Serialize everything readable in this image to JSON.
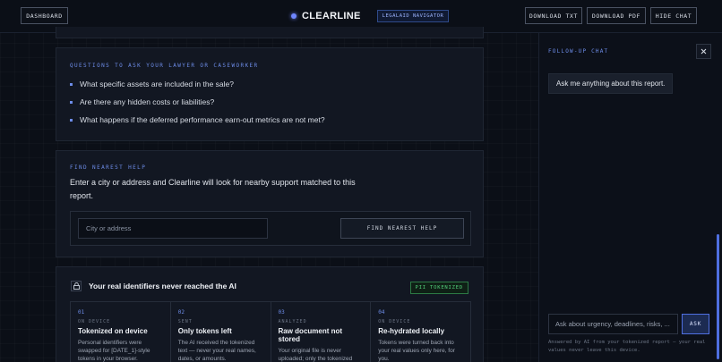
{
  "topbar": {
    "dashboard_label": "DASHBOARD",
    "brand_name": "CLEARLINE",
    "brand_tag": "LEGALAID NAVIGATOR",
    "download_txt_label": "DOWNLOAD TXT",
    "download_pdf_label": "DOWNLOAD PDF",
    "hide_chat_label": "HIDE CHAT"
  },
  "questions": {
    "label": "QUESTIONS TO ASK YOUR LAWYER OR CASEWORKER",
    "items": [
      "What specific assets are included in the sale?",
      "Are there any hidden costs or liabilities?",
      "What happens if the deferred performance earn-out metrics are not met?"
    ]
  },
  "find_help": {
    "label": "FIND NEAREST HELP",
    "description": "Enter a city or address and Clearline will look for nearby support matched to this report.",
    "input_placeholder": "City or address",
    "button_label": "FIND NEAREST HELP"
  },
  "pii": {
    "title": "Your real identifiers never reached the AI",
    "badge": "PII TOKENIZED",
    "steps": [
      {
        "num": "01",
        "tag": "ON DEVICE",
        "title": "Tokenized on device",
        "desc": "Personal identifiers were swapped for [DATE_1]-style tokens in your browser."
      },
      {
        "num": "02",
        "tag": "SENT",
        "title": "Only tokens left",
        "desc": "The AI received the tokenized text — never your real names, dates, or amounts."
      },
      {
        "num": "03",
        "tag": "ANALYZED",
        "title": "Raw document not stored",
        "desc": "Your original file is never uploaded; only the tokenized text is processed."
      },
      {
        "num": "04",
        "tag": "ON DEVICE",
        "title": "Re-hydrated locally",
        "desc": "Tokens were turned back into your real values only here, for you."
      }
    ]
  },
  "chat": {
    "title": "FOLLOW-UP CHAT",
    "greeting": "Ask me anything about this report.",
    "input_placeholder": "Ask about urgency, deadlines, risks, ...",
    "ask_label": "ASK",
    "footnote": "Answered by AI from your tokenized report — your real values never leave this device."
  },
  "colors": {
    "accent": "#6d8ce8",
    "badge_green": "#53d17c",
    "background": "#0b0f17"
  }
}
